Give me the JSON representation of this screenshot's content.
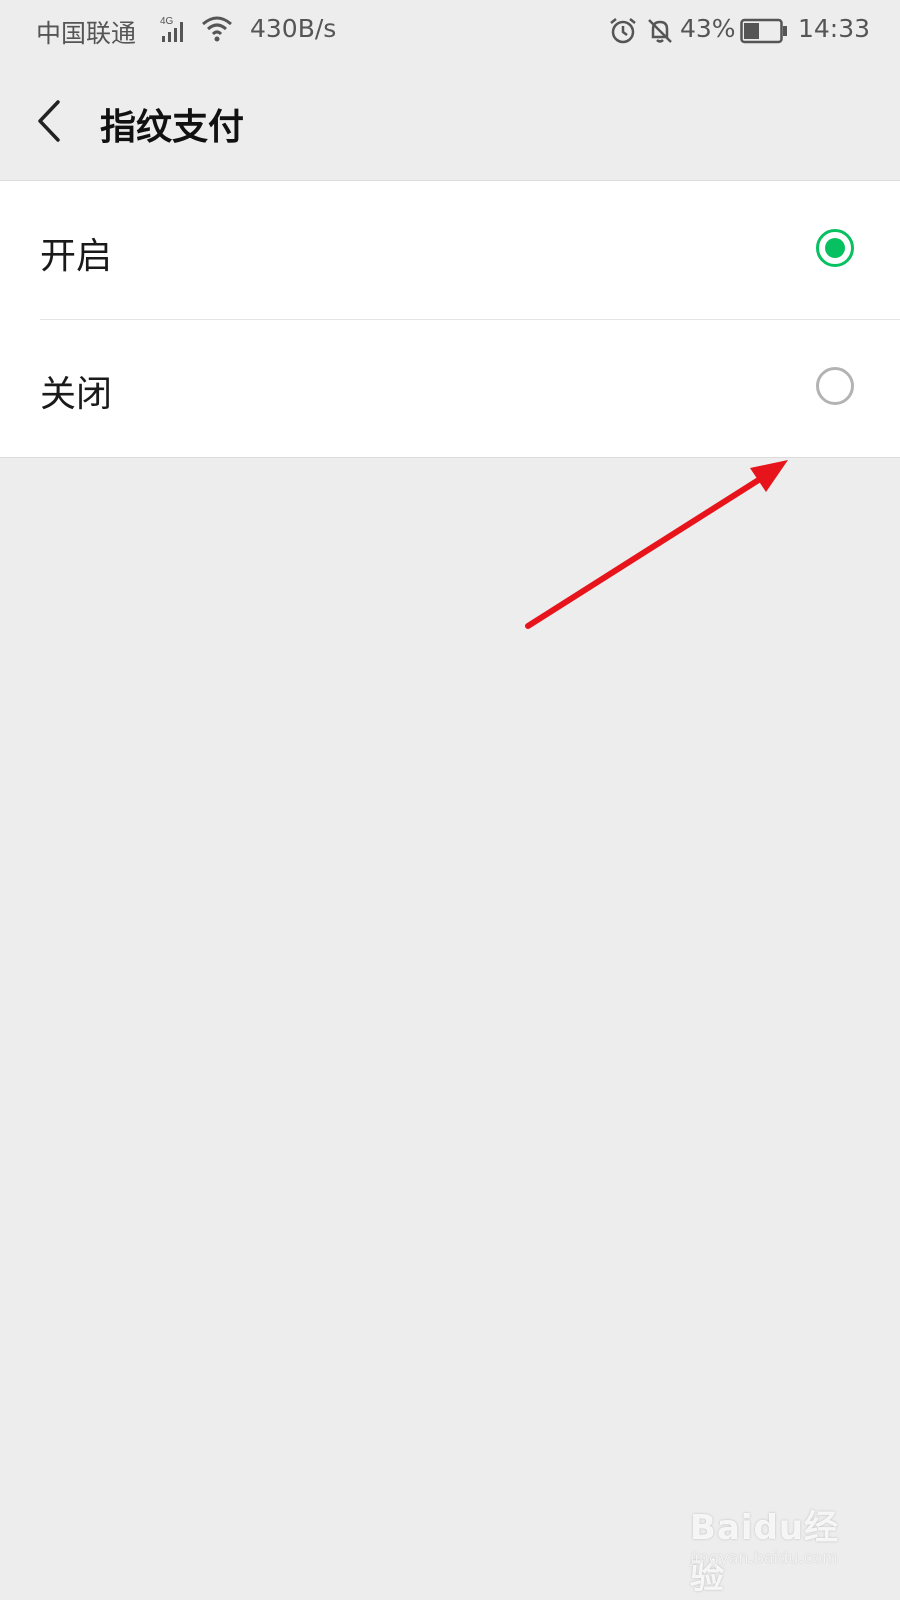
{
  "status_bar": {
    "carrier": "中国联通",
    "network": "4G",
    "speed": "430B/s",
    "battery_percent": "43%",
    "battery_level": 0.43,
    "time": "14:33",
    "icons": [
      "signal-icon",
      "wifi-icon",
      "alarm-icon",
      "bell-off-icon",
      "battery-icon"
    ]
  },
  "nav": {
    "back_icon": "chevron-left-icon",
    "title": "指纹支付"
  },
  "options": [
    {
      "label": "开启",
      "selected": true
    },
    {
      "label": "关闭",
      "selected": false
    }
  ],
  "colors": {
    "accent": "#07c160",
    "annotation_arrow": "#e8141b",
    "background": "#ededed"
  },
  "watermark": {
    "logo": "Baidu经验",
    "sub": "jingyan.baidu.com"
  }
}
